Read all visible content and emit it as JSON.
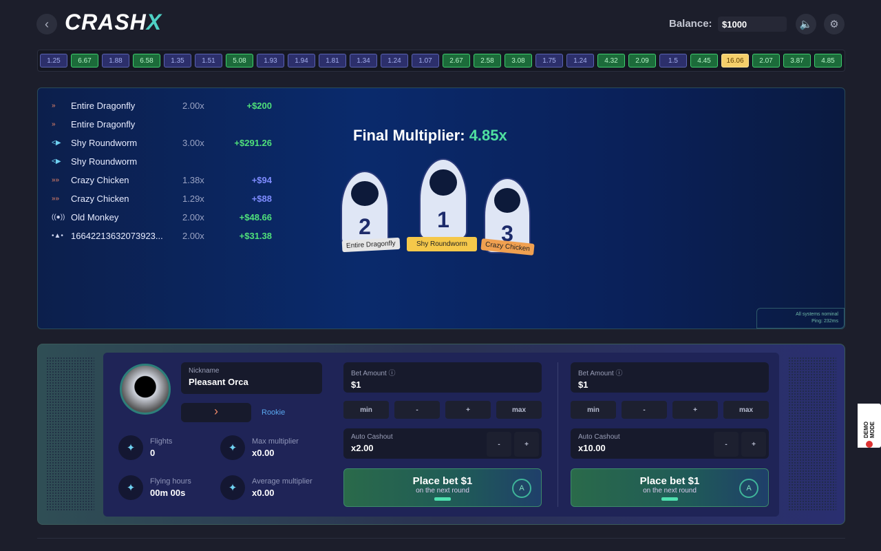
{
  "header": {
    "back_icon": "chevron-left-icon",
    "logo": "CRASH",
    "logo_accent": "X",
    "balance_label": "Balance:",
    "balance_value": "$1000",
    "sound_icon": "speaker-icon",
    "settings_icon": "gear-icon"
  },
  "history": [
    "1.25",
    "6.67",
    "1.88",
    "6.58",
    "1.35",
    "1.51",
    "5.08",
    "1.93",
    "1.94",
    "1.81",
    "1.34",
    "1.24",
    "1.07",
    "2.67",
    "2.58",
    "3.08",
    "1.75",
    "1.24",
    "4.32",
    "2.09",
    "1.5",
    "4.45",
    "16.06",
    "2.07",
    "3.87",
    "4.85"
  ],
  "colors": {
    "low": "#a6b0f0",
    "mid": "#3ecf6f",
    "high": "#f5cf6a",
    "win_green": "#4fe07a",
    "win_blue": "#7f8cff"
  },
  "leaderboard": [
    {
      "icon": "»",
      "name": "Entire Dragonfly",
      "mult": "2.00x",
      "win": "+$200",
      "tone": "green"
    },
    {
      "icon": "»",
      "name": "Entire Dragonfly",
      "mult": "",
      "win": "",
      "tone": "green"
    },
    {
      "icon": "<▶",
      "name": "Shy Roundworm",
      "mult": "3.00x",
      "win": "+$291.26",
      "tone": "green"
    },
    {
      "icon": "<▶",
      "name": "Shy Roundworm",
      "mult": "",
      "win": "",
      "tone": "green"
    },
    {
      "icon": "»»",
      "name": "Crazy Chicken",
      "mult": "1.38x",
      "win": "+$94",
      "tone": "blue"
    },
    {
      "icon": "»»",
      "name": "Crazy Chicken",
      "mult": "1.29x",
      "win": "+$88",
      "tone": "blue"
    },
    {
      "icon": "((●))",
      "name": "Old Monkey",
      "mult": "2.00x",
      "win": "+$48.66",
      "tone": "green"
    },
    {
      "icon": "•▲•",
      "name": "16642213632073923...",
      "mult": "2.00x",
      "win": "+$31.38",
      "tone": "green"
    }
  ],
  "game": {
    "final_label": "Final Multiplier:",
    "final_value": "4.85x",
    "podium": [
      {
        "place": "2",
        "name": "Entire Dragonfly"
      },
      {
        "place": "1",
        "name": "Shy Roundworm"
      },
      {
        "place": "3",
        "name": "Crazy Chicken"
      }
    ],
    "status": "All systems nominal",
    "ping": "Ping: 232ms"
  },
  "profile": {
    "nickname_label": "Nickname",
    "nickname": "Pleasant Orca",
    "rank": "Rookie",
    "stats": [
      {
        "label": "Flights",
        "value": "0",
        "icon": "rocket-icon"
      },
      {
        "label": "Max multiplier",
        "value": "x0.00",
        "icon": "planet-icon"
      },
      {
        "label": "Flying hours",
        "value": "00m 00s",
        "icon": "rocket-launch-icon"
      },
      {
        "label": "Average multiplier",
        "value": "x0.00",
        "icon": "helmet-icon"
      }
    ]
  },
  "bets": [
    {
      "bet_label": "Bet Amount ⓘ",
      "bet_value": "$1",
      "buttons": [
        "min",
        "-",
        "+",
        "max"
      ],
      "cashout_label": "Auto Cashout",
      "cashout_value": "x2.00",
      "minus": "-",
      "plus": "+",
      "place": "Place bet $1",
      "place_sub": "on the next round",
      "auto_icon": "A"
    },
    {
      "bet_label": "Bet Amount ⓘ",
      "bet_value": "$1",
      "buttons": [
        "min",
        "-",
        "+",
        "max"
      ],
      "cashout_label": "Auto Cashout",
      "cashout_value": "x10.00",
      "minus": "-",
      "plus": "+",
      "place": "Place bet $1",
      "place_sub": "on the next round",
      "auto_icon": "A"
    }
  ],
  "demo": "DEMO MODE"
}
